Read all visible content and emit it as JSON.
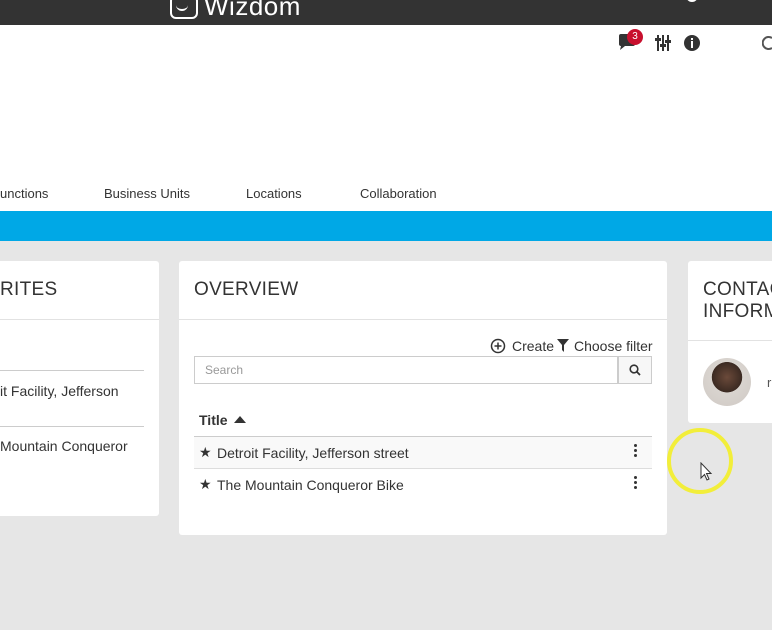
{
  "header": {
    "brand": "Wizdom"
  },
  "utility": {
    "notification_count": "3"
  },
  "nav": {
    "items": [
      {
        "label": "unctions"
      },
      {
        "label": "Business Units"
      },
      {
        "label": "Locations"
      },
      {
        "label": "Collaboration"
      }
    ]
  },
  "favorites": {
    "title": "RITES",
    "items": [
      "it Facility, Jefferson",
      "Mountain Conqueror"
    ]
  },
  "overview": {
    "title": "OVERVIEW",
    "create_label": "Create",
    "filter_label": "Choose filter",
    "search_placeholder": "Search",
    "column_title": "Title",
    "rows": [
      {
        "title": "Detroit Facility, Jefferson street"
      },
      {
        "title": "The Mountain Conqueror Bike"
      }
    ]
  },
  "contact": {
    "title_line1": "CONTAC",
    "title_line2": "INFORM",
    "name_initial": "r"
  },
  "colors": {
    "topbar": "#333333",
    "accent_bar": "#00a8e6",
    "badge": "#c8102e",
    "cursor_highlight": "#f2ee3a"
  }
}
